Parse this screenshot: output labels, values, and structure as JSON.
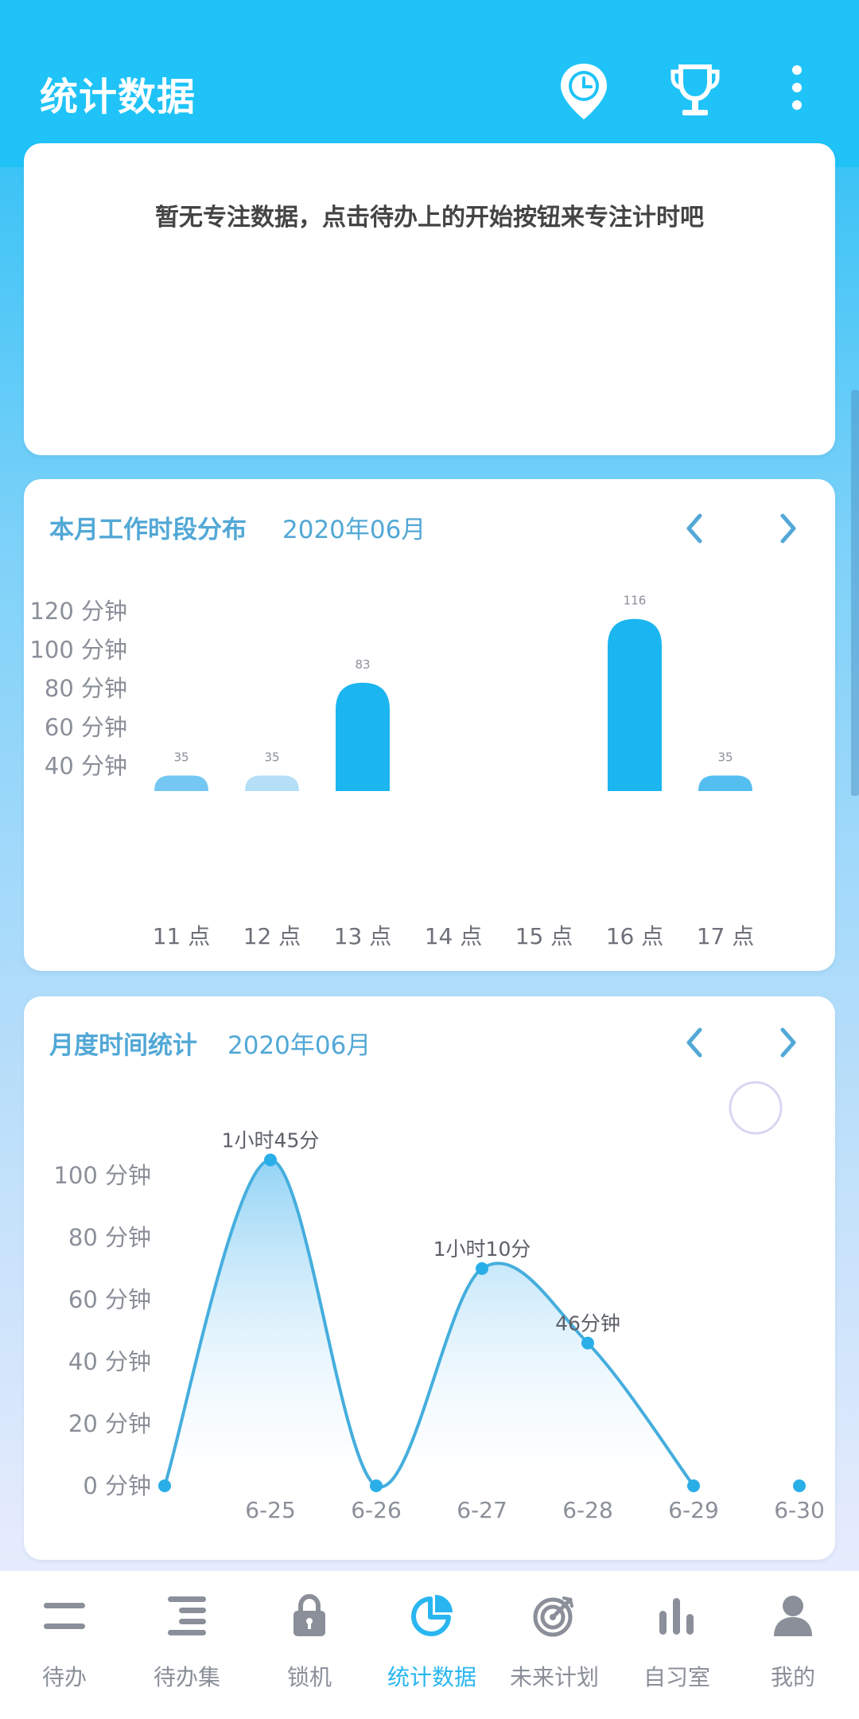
{
  "app_bar": {
    "title": "统计数据",
    "actions": [
      {
        "name": "focus-timer",
        "icon": "clock-pin-icon"
      },
      {
        "name": "achievements",
        "icon": "trophy-icon"
      },
      {
        "name": "more",
        "icon": "more-vertical-icon"
      }
    ]
  },
  "focus_card": {
    "empty_message": "暂无专注数据，点击待办上的开始按钮来专注计时吧"
  },
  "hourly_card": {
    "title": "本月工作时段分布",
    "month": "2020年06月",
    "prev_icon": "chevron-left-icon",
    "next_icon": "chevron-right-icon"
  },
  "monthly_card": {
    "title": "月度时间统计",
    "month": "2020年06月",
    "prev_icon": "chevron-left-icon",
    "next_icon": "chevron-right-icon"
  },
  "chart_data": [
    {
      "type": "bar",
      "categories": [
        "11 点",
        "12 点",
        "13 点",
        "14 点",
        "15 点",
        "16 点",
        "17 点"
      ],
      "values": [
        35,
        35,
        83,
        null,
        null,
        116,
        35
      ],
      "value_labels": [
        "35",
        "35",
        "83",
        "",
        "",
        "116",
        "35"
      ],
      "y_tick_labels": [
        "120 分钟",
        "100 分钟",
        "80 分钟",
        "60 分钟",
        "40 分钟"
      ],
      "y_ticks": [
        120,
        100,
        80,
        60,
        40
      ],
      "ylim": [
        27,
        120
      ],
      "colors": [
        "#74c7f2",
        "#b5dff7",
        "#1bb5f0",
        "#1bb5f0",
        "#1bb5f0",
        "#1bb5f0",
        "#55bef0"
      ],
      "grid": false
    },
    {
      "type": "area",
      "x_labels": [
        "",
        "6-25",
        "6-26",
        "6-27",
        "6-28",
        "6-29",
        "6-30"
      ],
      "values": [
        0,
        105,
        0,
        70,
        46,
        0,
        0
      ],
      "point_labels": [
        "",
        "1小时45分",
        "",
        "1小时10分",
        "46分钟",
        "",
        ""
      ],
      "y_tick_labels": [
        "100 分钟",
        "80 分钟",
        "60 分钟",
        "40 分钟",
        "20 分钟",
        "0 分钟"
      ],
      "y_ticks": [
        100,
        80,
        60,
        40,
        20,
        0
      ],
      "ylim": [
        0,
        105
      ],
      "line_color": "#45aedd",
      "point_color": "#2aaee8",
      "grid": false
    }
  ],
  "bottom_nav": {
    "tabs": [
      {
        "label": "待办",
        "icon": "todo-icon",
        "active": false
      },
      {
        "label": "待办集",
        "icon": "todo-list-icon",
        "active": false
      },
      {
        "label": "锁机",
        "icon": "lock-icon",
        "active": false
      },
      {
        "label": "统计数据",
        "icon": "pie-chart-icon",
        "active": true
      },
      {
        "label": "未来计划",
        "icon": "target-icon",
        "active": false
      },
      {
        "label": "自习室",
        "icon": "bar-chart-icon",
        "active": false
      },
      {
        "label": "我的",
        "icon": "user-icon",
        "active": false
      }
    ]
  },
  "colors": {
    "primary": "#1fc3f8",
    "accent": "#29b6f0",
    "title_text": "#52a8d6",
    "inactive_tab": "#8a8f99"
  }
}
